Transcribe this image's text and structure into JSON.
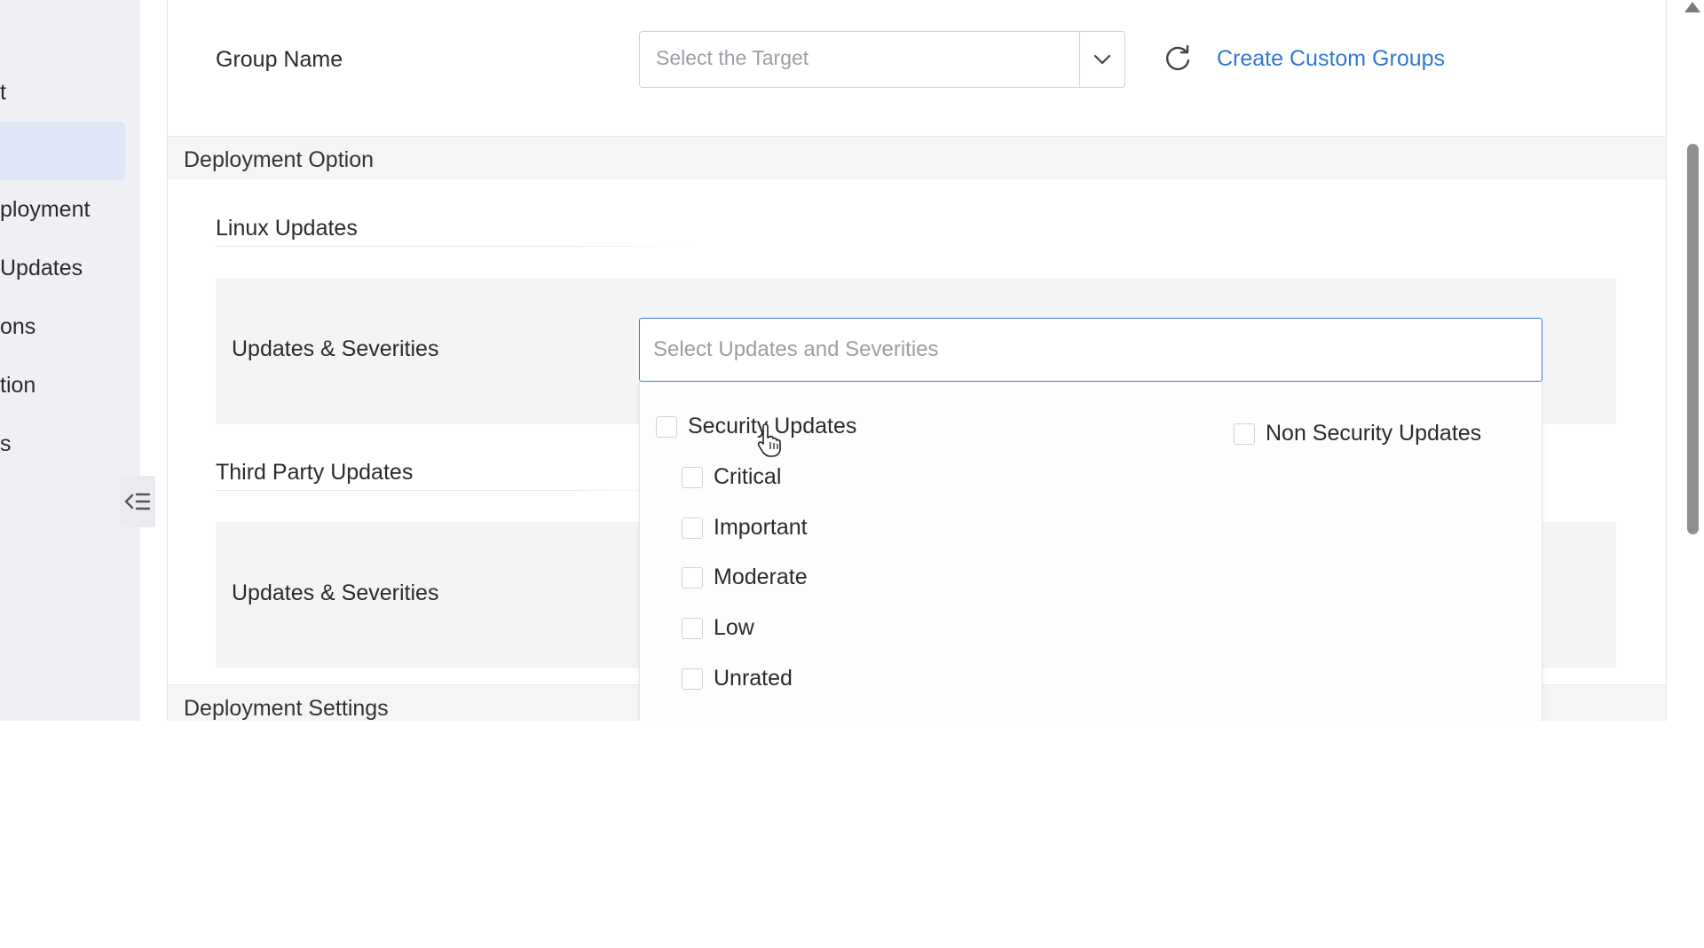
{
  "sidebar": {
    "items": [
      {
        "label": "t"
      },
      {
        "label": ""
      },
      {
        "label": "ployment"
      },
      {
        "label": "Updates"
      },
      {
        "label": "ons"
      },
      {
        "label": "tion"
      },
      {
        "label": "s"
      }
    ]
  },
  "header": {
    "group_name_label": "Group Name",
    "target_placeholder": "Select the Target",
    "create_link": "Create Custom Groups"
  },
  "deployment_option": {
    "title": "Deployment Option",
    "linux_title": "Linux Updates",
    "linux_updates_label": "Updates & Severities",
    "linux_select_placeholder": "Select Updates and Severities",
    "third_party_title": "Third Party Updates",
    "third_party_updates_label": "Updates & Severities"
  },
  "dropdown": {
    "group_label": "Security Updates",
    "severities": [
      "Critical",
      "Important",
      "Moderate",
      "Low",
      "Unrated"
    ],
    "non_security_label": "Non Security Updates"
  },
  "deployment_settings": {
    "title": "Deployment Settings"
  },
  "colors": {
    "accent": "#3b7ddd",
    "link": "#2f78d4",
    "sidebar_bg": "#eef0f3",
    "sidebar_active": "#dde5f7",
    "section_bg": "#f4f5f7"
  },
  "icons": [
    "chevron-down-icon",
    "refresh-icon",
    "collapse-sidebar-icon",
    "pointer-cursor-icon"
  ]
}
